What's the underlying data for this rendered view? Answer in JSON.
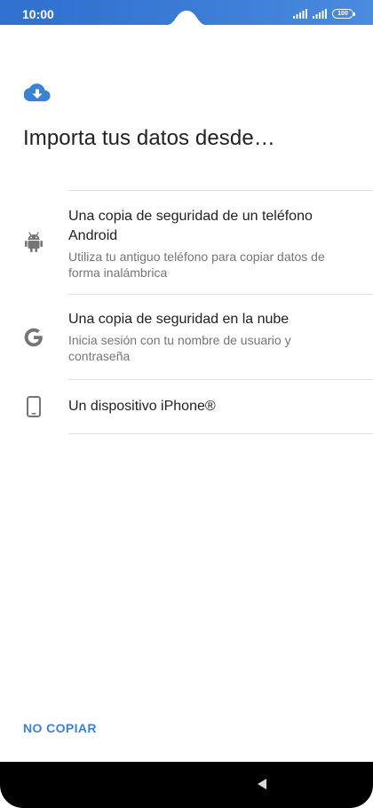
{
  "status_bar": {
    "time": "10:00",
    "battery": "100",
    "accent_color": "#3a7bd5"
  },
  "header": {
    "icon": "cloud-download-icon",
    "title": "Importa tus datos desde…"
  },
  "options": [
    {
      "icon": "android-icon",
      "title": "Una copia de seguridad de un teléfono Android",
      "subtitle": "Utiliza tu antiguo teléfono para copiar datos de forma inalámbrica"
    },
    {
      "icon": "google-icon",
      "title": "Una copia de seguridad en la nube",
      "subtitle": "Inicia sesión con tu nombre de usuario y contraseña"
    },
    {
      "icon": "smartphone-icon",
      "title": "Un dispositivo iPhone®",
      "subtitle": ""
    }
  ],
  "footer": {
    "skip_label": "NO COPIAR",
    "skip_color": "#3b82d6"
  },
  "navigation": {
    "back_icon": "back-triangle-icon"
  }
}
